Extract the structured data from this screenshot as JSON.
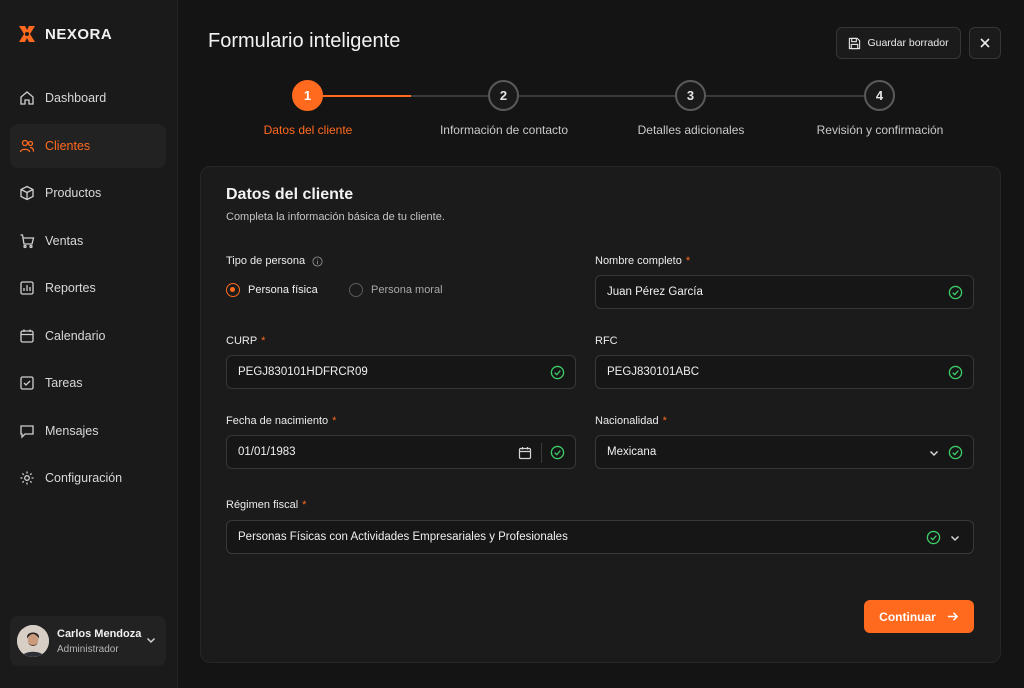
{
  "app": {
    "name": "NEXORA"
  },
  "colors": {
    "accent": "#ff6a1f",
    "success": "#3ecf6a",
    "background": "#141414"
  },
  "sidebar": {
    "items": [
      {
        "label": "Dashboard",
        "icon": "home-icon"
      },
      {
        "label": "Clientes",
        "icon": "users-icon",
        "active": true
      },
      {
        "label": "Productos",
        "icon": "box-icon"
      },
      {
        "label": "Ventas",
        "icon": "cart-icon"
      },
      {
        "label": "Reportes",
        "icon": "chart-icon"
      },
      {
        "label": "Calendario",
        "icon": "calendar-icon"
      },
      {
        "label": "Tareas",
        "icon": "task-icon"
      },
      {
        "label": "Mensajes",
        "icon": "message-icon"
      },
      {
        "label": "Configuración",
        "icon": "gear-icon"
      }
    ],
    "user": {
      "name": "Carlos Mendoza",
      "role": "Administrador"
    }
  },
  "header": {
    "title": "Formulario inteligente",
    "save_draft_label": "Guardar borrador"
  },
  "stepper": {
    "progress_fraction": 0.5,
    "steps": [
      {
        "number": "1",
        "label": "Datos del cliente",
        "active": true
      },
      {
        "number": "2",
        "label": "Información de contacto"
      },
      {
        "number": "3",
        "label": "Detalles adicionales"
      },
      {
        "number": "4",
        "label": "Revisión y confirmación"
      }
    ]
  },
  "form": {
    "title": "Datos del cliente",
    "subtitle": "Completa la información básica de tu cliente.",
    "person_type": {
      "label": "Tipo de persona",
      "options": [
        "Persona física",
        "Persona moral"
      ],
      "selected": "Persona física"
    },
    "full_name": {
      "label": "Nombre completo",
      "required": "*",
      "value": "Juan Pérez García"
    },
    "curp": {
      "label": "CURP",
      "required": "*",
      "value": "PEGJ830101HDFRCR09"
    },
    "rfc": {
      "label": "RFC",
      "value": "PEGJ830101ABC"
    },
    "birth_date": {
      "label": "Fecha de nacimiento",
      "required": "*",
      "value": "01/01/1983"
    },
    "nationality": {
      "label": "Nacionalidad",
      "required": "*",
      "value": "Mexicana"
    },
    "tax_regime": {
      "label": "Régimen fiscal",
      "required": "*",
      "value": "Personas Físicas con Actividades Empresariales y Profesionales"
    },
    "continue_label": "Continuar"
  }
}
